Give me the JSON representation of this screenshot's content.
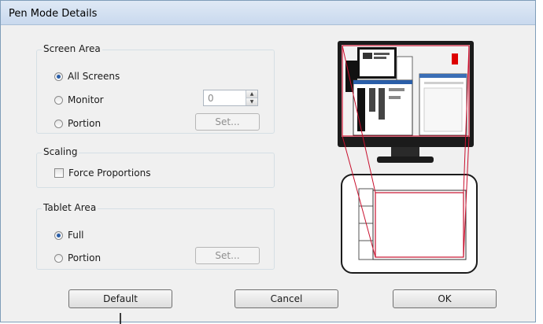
{
  "window": {
    "title": "Pen Mode Details"
  },
  "screen_area": {
    "title": "Screen Area",
    "options": [
      {
        "label": "All Screens",
        "checked": true
      },
      {
        "label": "Monitor",
        "checked": false
      },
      {
        "label": "Portion",
        "checked": false
      }
    ],
    "monitor_value": "0",
    "set_label": "Set..."
  },
  "scaling": {
    "title": "Scaling",
    "force_proportions": {
      "label": "Force Proportions",
      "checked": false
    }
  },
  "tablet_area": {
    "title": "Tablet Area",
    "options": [
      {
        "label": "Full",
        "checked": true
      },
      {
        "label": "Portion",
        "checked": false
      }
    ],
    "set_label": "Set..."
  },
  "buttons": {
    "default": "Default",
    "cancel": "Cancel",
    "ok": "OK"
  },
  "colors": {
    "mapping_line": "#c8102e",
    "title_bar": "#dfe9f5"
  }
}
